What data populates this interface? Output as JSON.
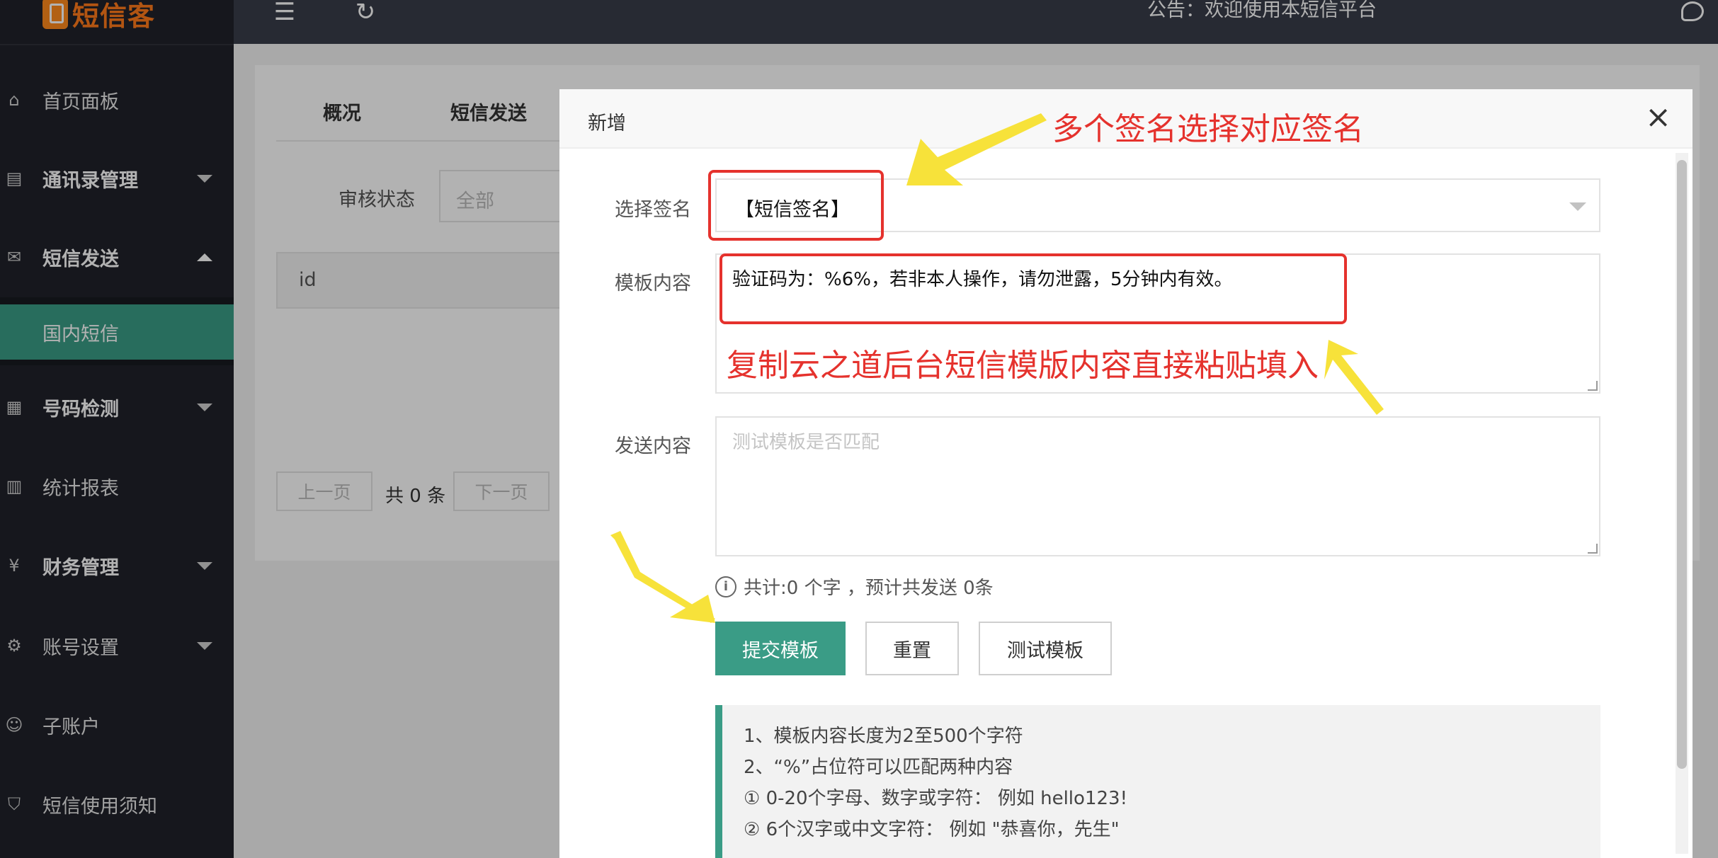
{
  "brand": {
    "name": "短信客",
    "color": "#ff7a1a"
  },
  "topbar": {
    "notice": "公告：欢迎使用本短信平台"
  },
  "sidebar": {
    "items": [
      {
        "label": "首页面板",
        "icon": "home-icon"
      },
      {
        "label": "通讯录管理",
        "icon": "contacts-icon"
      },
      {
        "label": "短信发送",
        "icon": "mail-icon"
      },
      {
        "label": "国内短信"
      },
      {
        "label": "号码检测",
        "icon": "number-check-icon"
      },
      {
        "label": "统计报表",
        "icon": "report-icon"
      },
      {
        "label": "财务管理",
        "icon": "yen-icon"
      },
      {
        "label": "账号设置",
        "icon": "gear-icon"
      },
      {
        "label": "子账户",
        "icon": "user-icon"
      },
      {
        "label": "短信使用须知",
        "icon": "shield-icon"
      }
    ]
  },
  "background_page": {
    "tabs": [
      "概况",
      "短信发送"
    ],
    "filter_label": "审核状态",
    "filter_value": "全部",
    "table_header": "id",
    "prev": "上一页",
    "total": "共 0 条",
    "next": "下一页"
  },
  "modal": {
    "title": "新增",
    "close": "×",
    "signature_label": "选择签名",
    "signature_value": "【短信签名】",
    "template_label": "模板内容",
    "template_value": "验证码为：%6%，若非本人操作，请勿泄露，5分钟内有效。",
    "send_label": "发送内容",
    "send_placeholder": "测试模板是否匹配",
    "count_text": "共计:0 个字 ，预计共发送 0条",
    "submit": "提交模板",
    "reset": "重置",
    "test": "测试模板",
    "tips": [
      "1、模板内容长度为2至500个字符",
      "2、“%”占位符可以匹配两种内容",
      "① 0-20个字母、数字或字符： 例如 hello123!",
      "② 6个汉字或中文字符： 例如 \"恭喜你，先生\""
    ]
  },
  "annotations": {
    "signature_note": "多个签名选择对应签名",
    "template_note": "复制云之道后台短信模版内容直接粘贴填入",
    "colors": {
      "box": "#e5322d",
      "arrow": "#f7e23a"
    }
  },
  "colors": {
    "accent": "#3a9c86",
    "sidebar": "#20222a",
    "topbar": "#393d49"
  }
}
